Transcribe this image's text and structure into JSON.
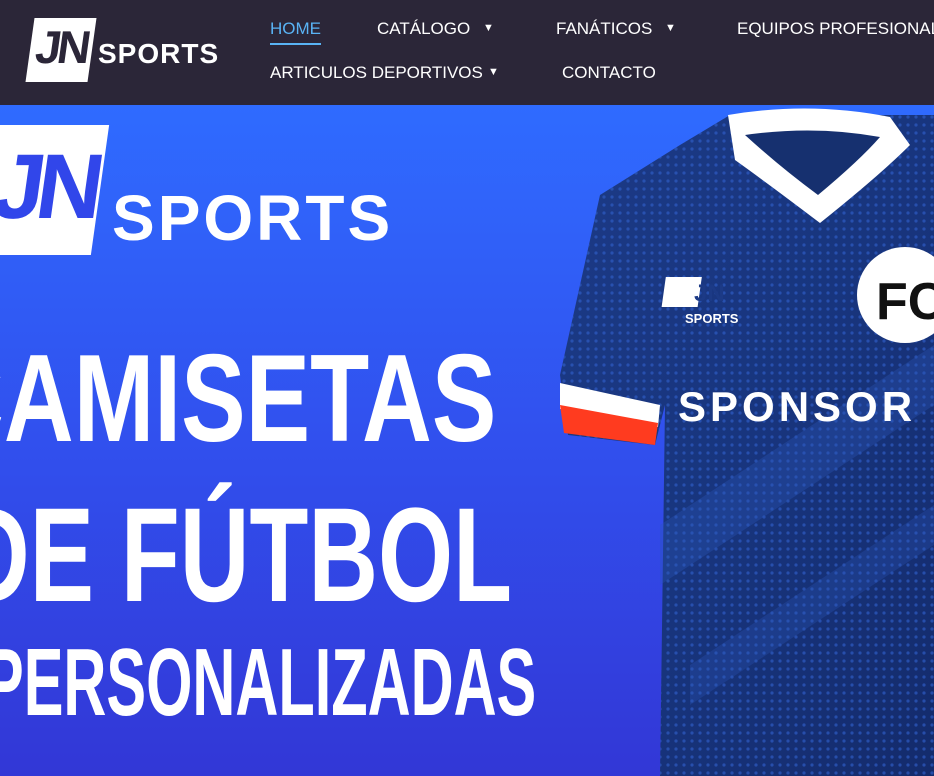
{
  "brand": {
    "logo_mark": "JN",
    "logo_word": "SPORTS"
  },
  "nav": {
    "items": [
      {
        "label": "HOME",
        "active": true,
        "dropdown": false
      },
      {
        "label": "CATÁLOGO",
        "dropdown": true
      },
      {
        "label": "FANÁTICOS",
        "dropdown": true
      },
      {
        "label": "EQUIPOS PROFESIONALES",
        "dropdown": false
      },
      {
        "label": "ARTICULOS DEPORTIVOS",
        "dropdown": true
      },
      {
        "label": "CONTACTO",
        "dropdown": false
      }
    ]
  },
  "hero": {
    "logo_mark": "JN",
    "logo_word": "SPORTS",
    "headline_1": "CAMISETAS",
    "headline_2": "DE FÚTBOL",
    "headline_3": "PERSONALIZADAS",
    "shirt_badge": "FC",
    "shirt_sponsor": "SPONSOR",
    "shirt_logo_mark": "JN",
    "shirt_logo_word": "SPORTS"
  },
  "colors": {
    "topbar": "#2b2638",
    "accent": "#59b3f5",
    "hero": "#3150ee"
  }
}
